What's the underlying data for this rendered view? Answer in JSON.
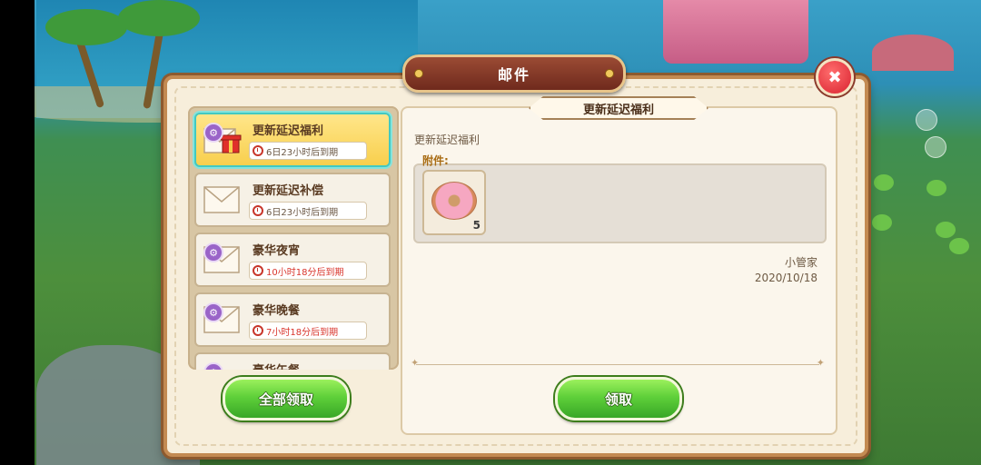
{
  "dialog": {
    "title": "邮件"
  },
  "mail_list": [
    {
      "title": "更新延迟福利",
      "expiry": "6日23小时后到期",
      "has_gift": true,
      "selected": true,
      "expiry_color": "#6a5643"
    },
    {
      "title": "更新延迟补偿",
      "expiry": "6日23小时后到期",
      "has_gift": false,
      "selected": false,
      "expiry_color": "#6a5643"
    },
    {
      "title": "豪华夜宵",
      "expiry": "10小时18分后到期",
      "has_gift": false,
      "selected": false,
      "expiry_color": "#d9342b"
    },
    {
      "title": "豪华晚餐",
      "expiry": "7小时18分后到期",
      "has_gift": false,
      "selected": false,
      "expiry_color": "#d9342b"
    },
    {
      "title": "豪华午餐"
    }
  ],
  "detail": {
    "heading": "更新延迟福利",
    "body": "更新延迟福利",
    "attachment_label": "附件:",
    "attachment": {
      "icon": "donut-icon",
      "count": "5"
    },
    "sender": "小管家",
    "date": "2020/10/18"
  },
  "buttons": {
    "claim_all": "全部领取",
    "claim": "领取"
  },
  "colors": {
    "accent_green": "#5fd03a",
    "selected_border": "#42c9c2",
    "title_plate": "#9b4b34"
  }
}
